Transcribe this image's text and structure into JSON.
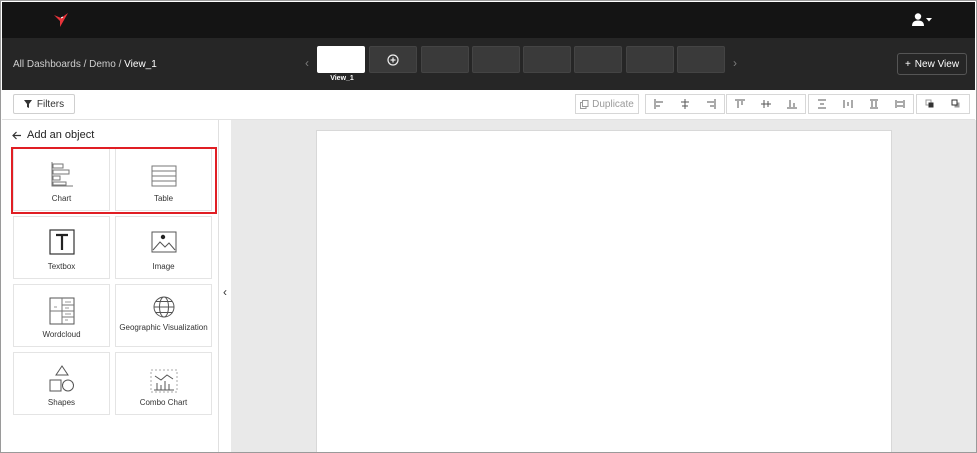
{
  "header": {
    "logo_icon": "hummingbird-logo-icon",
    "user_icon": "user-menu-icon"
  },
  "nav": {
    "breadcrumb": {
      "path": "All Dashboards / Demo / ",
      "current": "View_1"
    },
    "active_view_label": "View_1",
    "new_view_label": "New View"
  },
  "toolbar": {
    "filters_label": "Filters",
    "duplicate_label": "Duplicate"
  },
  "panel": {
    "title": "Add an object",
    "objects": [
      {
        "label": "Chart",
        "icon": "chart-icon"
      },
      {
        "label": "Table",
        "icon": "table-icon"
      },
      {
        "label": "Textbox",
        "icon": "textbox-icon"
      },
      {
        "label": "Image",
        "icon": "image-icon"
      },
      {
        "label": "Wordcloud",
        "icon": "wordcloud-icon"
      },
      {
        "label": "Geographic Visualization",
        "icon": "globe-icon"
      },
      {
        "label": "Shapes",
        "icon": "shapes-icon"
      },
      {
        "label": "Combo Chart",
        "icon": "combo-chart-icon"
      }
    ]
  },
  "colors": {
    "topbar": "#141414",
    "navbar": "#262626",
    "highlight": "#e01e24",
    "workspace": "#e9e9e9"
  }
}
